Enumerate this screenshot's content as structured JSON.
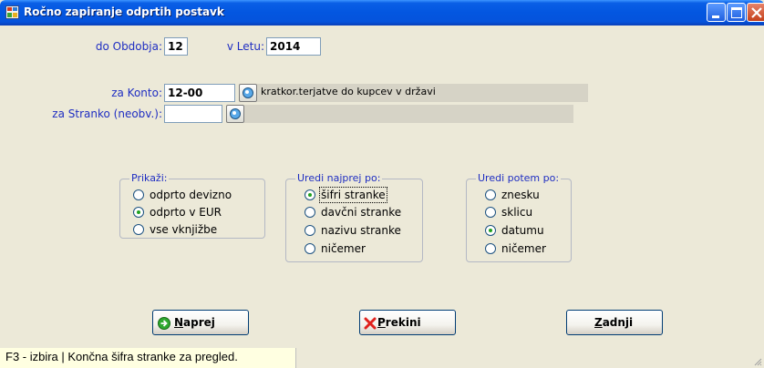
{
  "window": {
    "title": "Ročno zapiranje odprtih postavk",
    "controls": [
      "minimize",
      "maximize",
      "close"
    ]
  },
  "period": {
    "label": "do Obdobja:",
    "value": "12"
  },
  "year": {
    "label": "v Letu:",
    "value": "2014"
  },
  "konto": {
    "label": "za Konto:",
    "value": "12-00",
    "description": "kratkor.terjatve do kupcev v državi",
    "lookup_icon": "search-icon"
  },
  "stranka": {
    "label": "za Stranko (neobv.):",
    "value": "",
    "description": "",
    "lookup_icon": "search-icon"
  },
  "prikazi": {
    "title": "Prikaži:",
    "options": [
      {
        "label": "odprto devizno",
        "selected": false
      },
      {
        "label": "odprto v EUR",
        "selected": true
      },
      {
        "label": "vse vknjižbe",
        "selected": false
      }
    ]
  },
  "uredi_najprej": {
    "title": "Uredi najprej po:",
    "options": [
      {
        "label": "šifri stranke",
        "selected": true
      },
      {
        "label": "davčni stranke",
        "selected": false
      },
      {
        "label": "nazivu stranke",
        "selected": false
      },
      {
        "label": "ničemer",
        "selected": false
      }
    ]
  },
  "uredi_potem": {
    "title": "Uredi potem po:",
    "options": [
      {
        "label": "znesku",
        "selected": false
      },
      {
        "label": "sklicu",
        "selected": false
      },
      {
        "label": "datumu",
        "selected": true
      },
      {
        "label": "ničemer",
        "selected": false
      }
    ]
  },
  "buttons": {
    "naprej": {
      "mnemonic": "N",
      "rest": "aprej",
      "icon": "arrow-right-icon"
    },
    "prekini": {
      "mnemonic": "P",
      "rest": "rekini",
      "icon": "x-icon"
    },
    "zadnji": {
      "mnemonic": "Z",
      "rest": "adnji"
    }
  },
  "status": {
    "text": "F3 - izbira | Končna šifra stranke za pregled."
  },
  "colors": {
    "label": "#1f2ec2",
    "titlebar": "#0356e0",
    "face": "#ece9d8",
    "radio_dot": "#21a121"
  }
}
